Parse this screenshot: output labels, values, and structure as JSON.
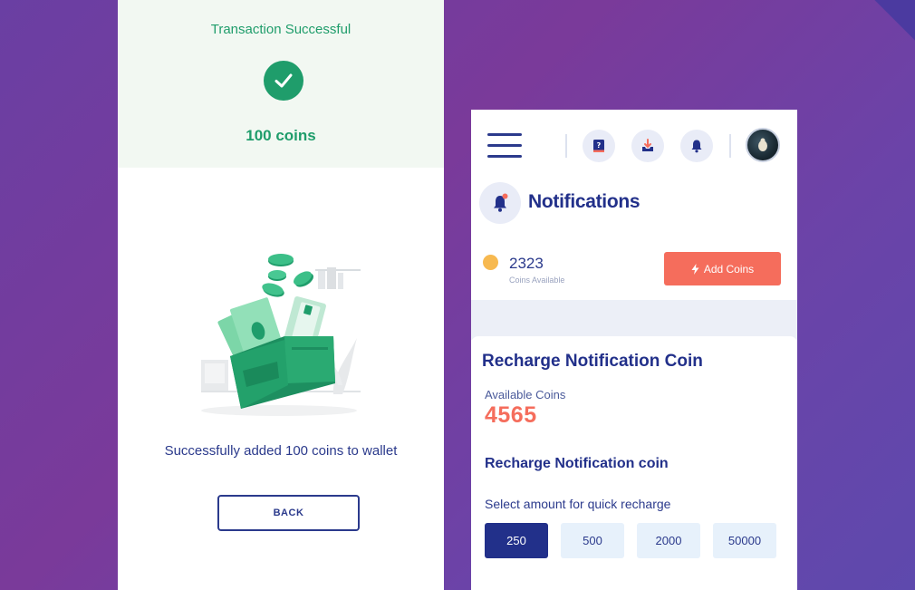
{
  "left": {
    "success_title": "Transaction Successful",
    "coins_amount": "100 coins",
    "success_message": "Successfully added 100 coins to wallet",
    "back_label": "BACK"
  },
  "right": {
    "page_title": "Notifications",
    "coins_value": "2323",
    "coins_caption": "Coins Available",
    "add_coins_label": "Add Coins",
    "card_title": "Recharge Notification Coin",
    "available_label": "Available Coins",
    "available_value": "4565",
    "section_title": "Recharge Notification coin",
    "select_label": "Select amount for quick recharge",
    "amounts": [
      "250",
      "500",
      "2000",
      "50000"
    ],
    "selected_amount": "250"
  },
  "icons": {
    "help": "help-book-icon",
    "download": "download-tray-icon",
    "bell": "bell-icon",
    "bolt": "bolt-icon",
    "check": "check-icon"
  },
  "colors": {
    "brand": "#22308a",
    "success": "#1f9d6b",
    "accent": "#f56d5c",
    "coin": "#f7b950"
  }
}
